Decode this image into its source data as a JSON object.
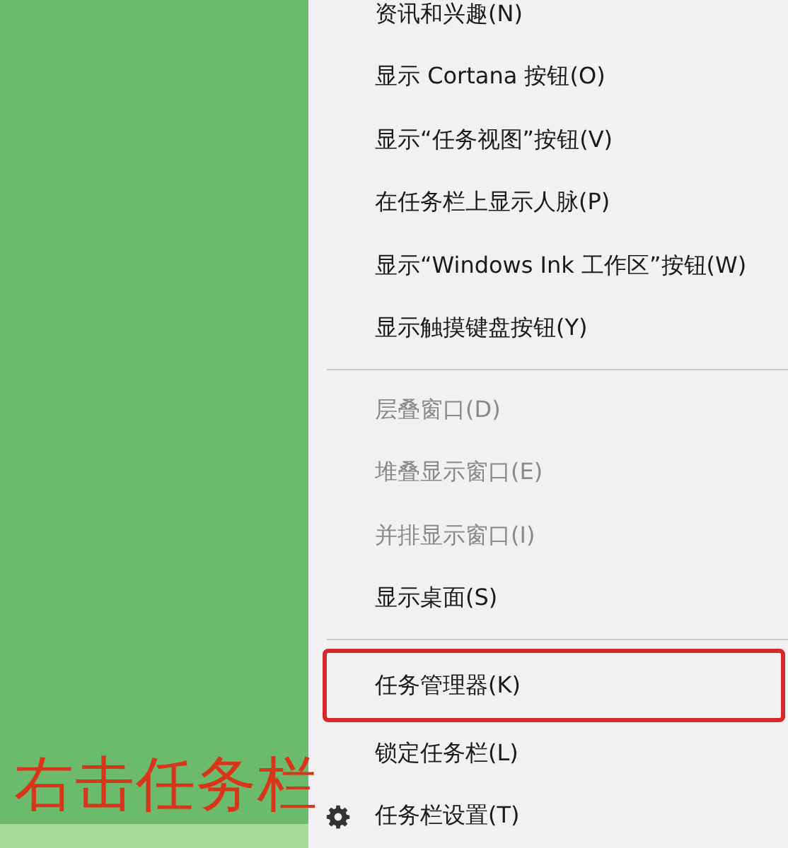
{
  "context_menu": {
    "items": [
      {
        "kind": "item",
        "label": "资讯和兴趣(N)",
        "disabled": false,
        "highlighted": false
      },
      {
        "kind": "item",
        "label": "显示 Cortana 按钮(O)",
        "disabled": false,
        "highlighted": false
      },
      {
        "kind": "item",
        "label": "显示“任务视图”按钮(V)",
        "disabled": false,
        "highlighted": false
      },
      {
        "kind": "item",
        "label": "在任务栏上显示人脉(P)",
        "disabled": false,
        "highlighted": false
      },
      {
        "kind": "item",
        "label": "显示“Windows Ink 工作区”按钮(W)",
        "disabled": false,
        "highlighted": false
      },
      {
        "kind": "item",
        "label": "显示触摸键盘按钮(Y)",
        "disabled": false,
        "highlighted": false
      },
      {
        "kind": "separator"
      },
      {
        "kind": "item",
        "label": "层叠窗口(D)",
        "disabled": true,
        "highlighted": false
      },
      {
        "kind": "item",
        "label": "堆叠显示窗口(E)",
        "disabled": true,
        "highlighted": false
      },
      {
        "kind": "item",
        "label": "并排显示窗口(I)",
        "disabled": true,
        "highlighted": false
      },
      {
        "kind": "item",
        "label": "显示桌面(S)",
        "disabled": false,
        "highlighted": false
      },
      {
        "kind": "separator"
      },
      {
        "kind": "item",
        "label": "任务管理器(K)",
        "disabled": false,
        "highlighted": true
      },
      {
        "kind": "item",
        "label": "锁定任务栏(L)",
        "disabled": false,
        "highlighted": false
      },
      {
        "kind": "settings",
        "label": "任务栏设置(T)",
        "disabled": false,
        "highlighted": false
      }
    ]
  },
  "annotation": "右击任务栏"
}
